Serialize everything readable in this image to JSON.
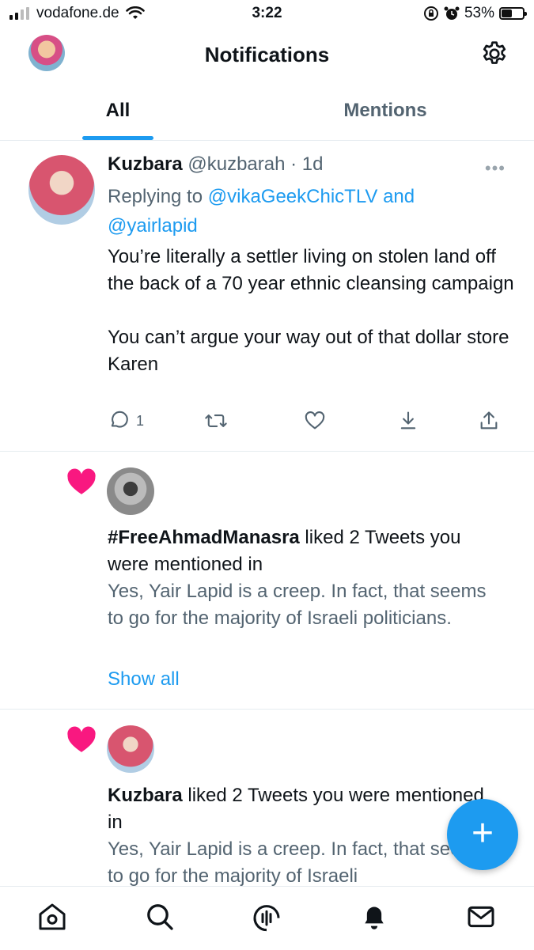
{
  "status_bar": {
    "carrier": "vodafone.de",
    "time": "3:22",
    "battery": "53%",
    "battery_level": 0.53
  },
  "header": {
    "title": "Notifications"
  },
  "tabs": [
    {
      "label": "All",
      "selected": true
    },
    {
      "label": "Mentions",
      "selected": false
    }
  ],
  "tweet": {
    "name": "Kuzbara",
    "handle_time": "@kuzbarah · 1d",
    "reply_prefix": "Replying to ",
    "reply_to_1": "@vikaGeekChicTLV",
    "reply_and": " and",
    "reply_to_2": "@yairlapid",
    "body": [
      "You’re literally a settler living on stolen land off the back of a 70 year ethnic cleansing campaign",
      "You can’t argue your way out of that dollar store Karen"
    ],
    "reply_count": "1"
  },
  "notifications": [
    {
      "actor": "#FreeAhmadManasra",
      "action": " liked 2 Tweets you were mentioned in",
      "preview": "Yes, Yair Lapid is a creep. In fact, that seems to go for the majority of Israeli politicians.",
      "show_all": "Show all"
    },
    {
      "actor": "Kuzbara",
      "action": " liked 2 Tweets you were mentioned in",
      "preview": "Yes, Yair Lapid is a creep. In fact, that seems to go for the majority of Israeli"
    }
  ],
  "colors": {
    "accent": "#1d9bf0",
    "heart": "#f91880",
    "secondary_text": "#536471"
  },
  "icons": [
    "wifi-icon",
    "gear-icon",
    "more-icon",
    "reply-icon",
    "retweet-icon",
    "like-icon",
    "download-icon",
    "share-icon",
    "heart-icon",
    "home-icon",
    "search-icon",
    "spaces-icon",
    "notifications-icon",
    "messages-icon",
    "compose-plus-icon"
  ]
}
